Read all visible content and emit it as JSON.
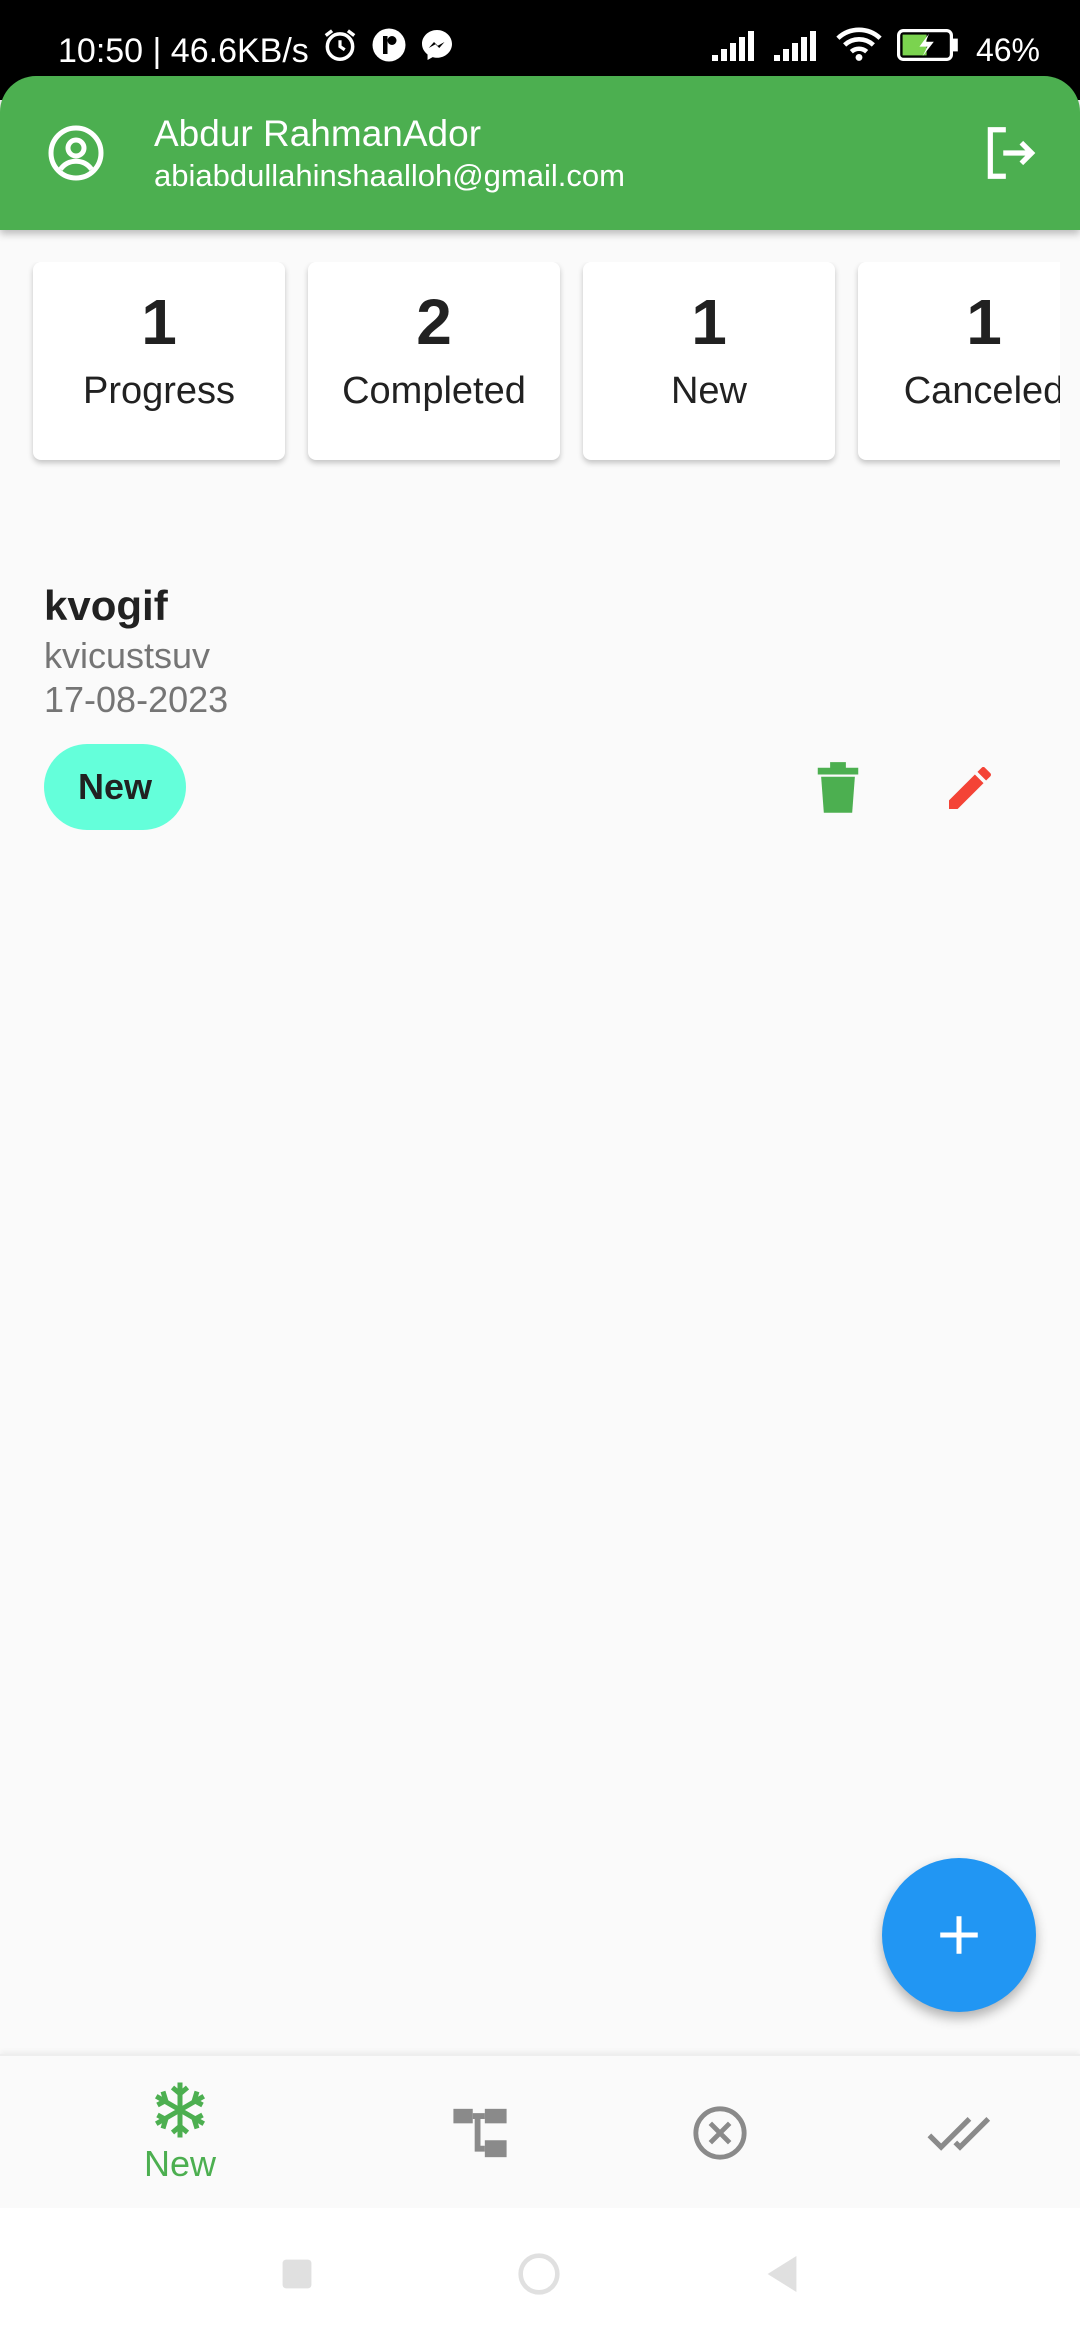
{
  "status_bar": {
    "time_speed": "10:50 | 46.6KB/s",
    "battery": "46%",
    "icons": [
      "alarm-icon",
      "notification-app-icon",
      "messenger-icon",
      "signal-icon",
      "signal-icon",
      "wifi-icon",
      "battery-charging-icon"
    ]
  },
  "header": {
    "user_name": "Abdur RahmanAdor",
    "user_email": "abiabdullahinshaalloh@gmail.com",
    "avatar_icon": "account-circle-icon",
    "logout_icon": "logout-icon",
    "background_color": "#4caf50"
  },
  "summary": [
    {
      "count": "1",
      "label": "Progress"
    },
    {
      "count": "2",
      "label": "Completed"
    },
    {
      "count": "1",
      "label": "New"
    },
    {
      "count": "1",
      "label": "Canceled"
    }
  ],
  "tasks": [
    {
      "title": "kvogif",
      "description": "kvicustsuv",
      "date": "17-08-2023",
      "status": "New",
      "status_color": "#64ffda",
      "delete_icon_color": "#4caf50",
      "edit_icon_color": "#f44336"
    }
  ],
  "fab": {
    "icon": "plus-icon",
    "color": "#2196f3"
  },
  "bottom_nav": {
    "active_index": 0,
    "items": [
      {
        "icon": "snowflake-icon",
        "label": "New"
      },
      {
        "icon": "hierarchy-icon"
      },
      {
        "icon": "cancel-circle-icon"
      },
      {
        "icon": "done-all-icon"
      }
    ]
  }
}
